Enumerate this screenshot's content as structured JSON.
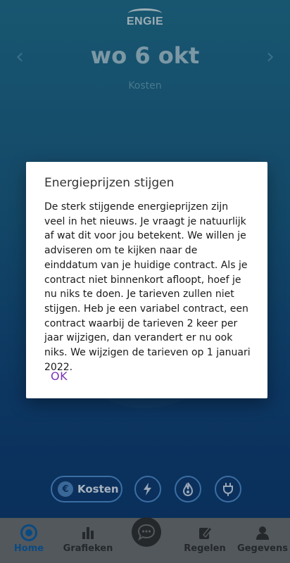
{
  "header": {
    "logo": "ENGIE",
    "date": "wo 6 okt",
    "subtitle": "Kosten",
    "prev_arrow": "‹",
    "next_arrow": "›"
  },
  "categories": {
    "kosten_label": "Kosten",
    "euro_symbol": "€",
    "icons": [
      "electricity-icon",
      "gas-flame-icon",
      "plug-icon"
    ]
  },
  "tabbar": {
    "home": "Home",
    "grafieken": "Grafieken",
    "regelen": "Regelen",
    "gegevens": "Gegevens"
  },
  "dialog": {
    "title": "Energieprijzen stijgen",
    "body": "De sterk stijgende energieprijzen zijn veel in het nieuws. Je vraagt je natuurlijk af wat dit voor jou betekent. We willen je adviseren om te kijken naar de einddatum van je huidige contract. Als je contract niet binnenkort afloopt, hoef je nu niks te doen. Je tarieven zullen niet stijgen. Heb je een variabel contract, een contract waarbij de tarieven 2 keer per jaar wijzigen, dan verandert er nu ook niks. We wijzigen de tarieven op 1 januari 2022.",
    "ok_label": "OK"
  },
  "colors": {
    "accent": "#7a34b8",
    "home_active": "#0d5fa8",
    "button_border": "#4c8ed2"
  }
}
